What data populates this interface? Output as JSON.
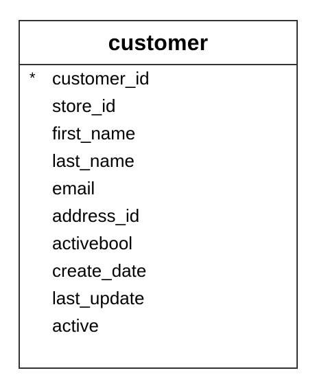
{
  "entity": {
    "title": "customer",
    "pk_marker": "*",
    "fields": [
      {
        "name": "customer_id",
        "primary_key": true
      },
      {
        "name": "store_id",
        "primary_key": false
      },
      {
        "name": "first_name",
        "primary_key": false
      },
      {
        "name": "last_name",
        "primary_key": false
      },
      {
        "name": "email",
        "primary_key": false
      },
      {
        "name": "address_id",
        "primary_key": false
      },
      {
        "name": "activebool",
        "primary_key": false
      },
      {
        "name": "create_date",
        "primary_key": false
      },
      {
        "name": "last_update",
        "primary_key": false
      },
      {
        "name": "active",
        "primary_key": false
      }
    ]
  }
}
